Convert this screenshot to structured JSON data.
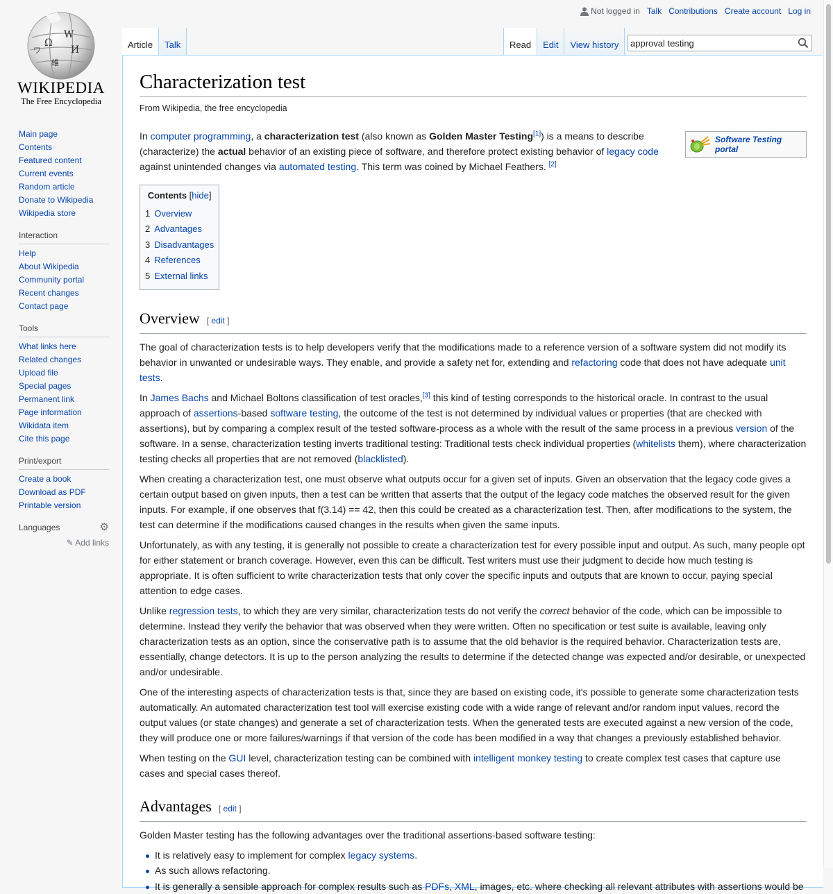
{
  "logo": {
    "wordmark": "WIKIPEDIA",
    "tagline": "The Free Encyclopedia",
    "icon": "wikipedia-globe-icon"
  },
  "personal": {
    "not_logged_in": "Not logged in",
    "talk": "Talk",
    "contributions": "Contributions",
    "create_account": "Create account",
    "log_in": "Log in"
  },
  "tabs": {
    "article": "Article",
    "talk": "Talk",
    "read": "Read",
    "edit": "Edit",
    "history": "View history"
  },
  "search": {
    "value": "approval testing",
    "icon": "search-icon"
  },
  "sidebar": {
    "nav": [
      "Main page",
      "Contents",
      "Featured content",
      "Current events",
      "Random article",
      "Donate to Wikipedia",
      "Wikipedia store"
    ],
    "interaction": {
      "heading": "Interaction",
      "items": [
        "Help",
        "About Wikipedia",
        "Community portal",
        "Recent changes",
        "Contact page"
      ]
    },
    "tools": {
      "heading": "Tools",
      "items": [
        "What links here",
        "Related changes",
        "Upload file",
        "Special pages",
        "Permanent link",
        "Page information",
        "Wikidata item",
        "Cite this page"
      ]
    },
    "print": {
      "heading": "Print/export",
      "items": [
        "Create a book",
        "Download as PDF",
        "Printable version"
      ]
    },
    "languages": {
      "heading": "Languages",
      "add_links": "Add links"
    }
  },
  "article": {
    "title": "Characterization test",
    "site_sub": "From Wikipedia, the free encyclopedia",
    "portal": "Software Testing portal",
    "intro": {
      "t1": "In ",
      "l1": "computer programming",
      "t2": ", a ",
      "b1": "characterization test",
      "t3": " (also known as ",
      "b2": "Golden Master Testing",
      "ref1": "[1]",
      "t4": ") is a means to describe (characterize) the ",
      "b3": "actual",
      "t5": " behavior of an existing piece of software, and therefore protect existing behavior of ",
      "l2": "legacy code",
      "t6": " against unintended changes via ",
      "l3": "automated testing",
      "t7": ". This term was coined by Michael Feathers. ",
      "ref2": "[2]"
    },
    "toc": {
      "title": "Contents",
      "hide": "hide",
      "items": [
        {
          "num": "1",
          "label": "Overview"
        },
        {
          "num": "2",
          "label": "Advantages"
        },
        {
          "num": "3",
          "label": "Disadvantages"
        },
        {
          "num": "4",
          "label": "References"
        },
        {
          "num": "5",
          "label": "External links"
        }
      ]
    },
    "overview": {
      "heading": "Overview",
      "edit": "edit",
      "p1": {
        "t1": "The goal of characterization tests is to help developers verify that the modifications made to a reference version of a software system did not modify its behavior in unwanted or undesirable ways. They enable, and provide a safety net for, extending and ",
        "l1": "refactoring",
        "t2": " code that does not have adequate ",
        "l2": "unit tests",
        "t3": "."
      },
      "p2": {
        "t1": "In ",
        "l1": "James Bachs",
        "t2": " and Michael Boltons classification of test oracles,",
        "ref": "[3]",
        "t3": " this kind of testing corresponds to the historical oracle. In contrast to the usual approach of ",
        "l2": "assertions",
        "t4": "-based ",
        "l3": "software testing",
        "t5": ", the outcome of the test is not determined by individual values or properties (that are checked with assertions), but by comparing a complex result of the tested software-process as a whole with the result of the same process in a previous ",
        "l4": "version",
        "t6": " of the software. In a sense, characterization testing inverts traditional testing: Traditional tests check individual properties (",
        "l5": "whitelists",
        "t7": " them), where characterization testing checks all properties that are not removed (",
        "l6": "blacklisted",
        "t8": ")."
      },
      "p3": "When creating a characterization test, one must observe what outputs occur for a given set of inputs. Given an observation that the legacy code gives a certain output based on given inputs, then a test can be written that asserts that the output of the legacy code matches the observed result for the given inputs. For example, if one observes that f(3.14) == 42, then this could be created as a characterization test. Then, after modifications to the system, the test can determine if the modifications caused changes in the results when given the same inputs.",
      "p4": "Unfortunately, as with any testing, it is generally not possible to create a characterization test for every possible input and output. As such, many people opt for either statement or branch coverage. However, even this can be difficult. Test writers must use their judgment to decide how much testing is appropriate. It is often sufficient to write characterization tests that only cover the specific inputs and outputs that are known to occur, paying special attention to edge cases.",
      "p5": {
        "t1": "Unlike ",
        "l1": "regression tests",
        "t2": ", to which they are very similar, characterization tests do not verify the ",
        "i1": "correct",
        "t3": " behavior of the code, which can be impossible to determine. Instead they verify the behavior that was observed when they were written. Often no specification or test suite is available, leaving only characterization tests as an option, since the conservative path is to assume that the old behavior is the required behavior. Characterization tests are, essentially, change detectors. It is up to the person analyzing the results to determine if the detected change was expected and/or desirable, or unexpected and/or undesirable."
      },
      "p6": "One of the interesting aspects of characterization tests is that, since they are based on existing code, it's possible to generate some characterization tests automatically. An automated characterization test tool will exercise existing code with a wide range of relevant and/or random input values, record the output values (or state changes) and generate a set of characterization tests. When the generated tests are executed against a new version of the code, they will produce one or more failures/warnings if that version of the code has been modified in a way that changes a previously established behavior.",
      "p7": {
        "t1": "When testing on the ",
        "l1": "GUI",
        "t2": " level, characterization testing can be combined with ",
        "l2": "intelligent monkey testing",
        "t3": " to create complex test cases that capture use cases and special cases thereof."
      }
    },
    "advantages": {
      "heading": "Advantages",
      "edit": "edit",
      "intro": "Golden Master testing has the following advantages over the traditional assertions-based software testing:",
      "li1": {
        "t1": "It is relatively easy to implement for complex ",
        "l1": "legacy systems",
        "t2": "."
      },
      "li2": "As such allows refactoring.",
      "li3": {
        "t1": "It is generally a sensible approach for complex results such as ",
        "l1": "PDFs",
        "t2": ", ",
        "l2": "XML",
        "t3": ", images, etc. where checking all relevant attributes with assertions would be"
      }
    }
  }
}
